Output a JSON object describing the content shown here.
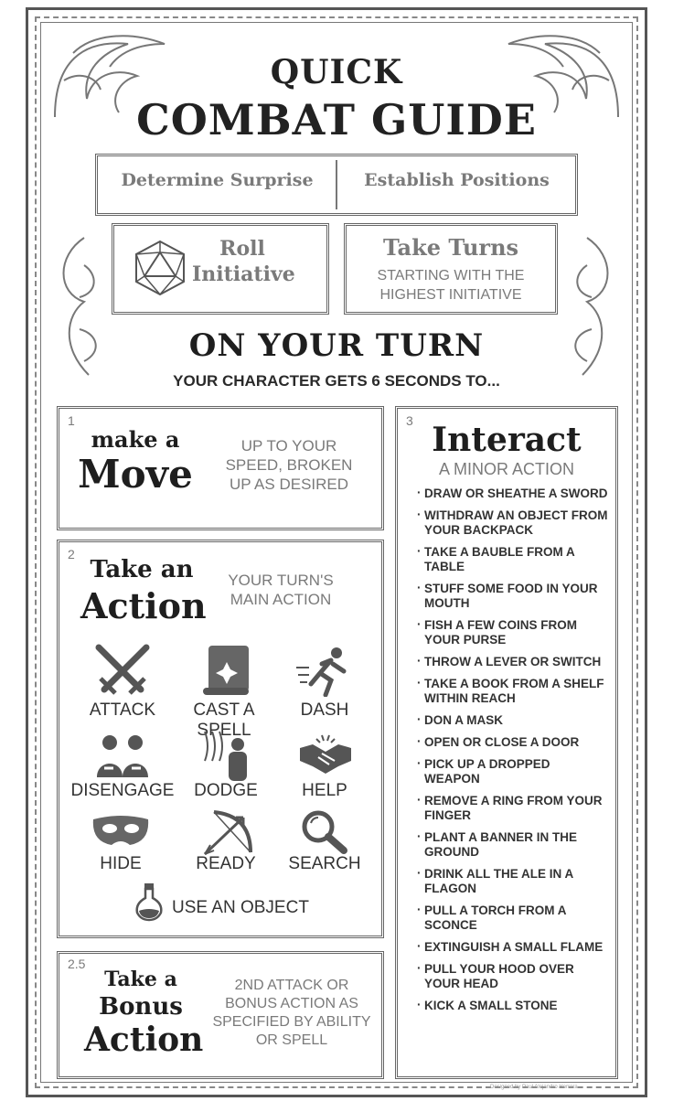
{
  "title": {
    "line1": "QUICK",
    "line2": "COMBAT GUIDE"
  },
  "setup": {
    "surprise": "Determine Surprise",
    "positions": "Establish Positions",
    "roll_initiative": "Roll Initiative",
    "take_turns_title": "Take Turns",
    "take_turns_desc": "STARTING WITH THE HIGHEST INITIATIVE"
  },
  "on_your_turn": {
    "heading": "ON YOUR TURN",
    "subheading": "YOUR CHARACTER GETS 6 SECONDS TO..."
  },
  "move": {
    "number": "1",
    "small": "make a",
    "big": "Move",
    "desc": "UP TO YOUR SPEED, BROKEN UP AS DESIRED"
  },
  "action": {
    "number": "2",
    "small": "Take an",
    "big": "Action",
    "desc": "YOUR TURN'S MAIN ACTION",
    "items": [
      {
        "label": "ATTACK",
        "icon": "crossed-swords-icon"
      },
      {
        "label": "CAST A SPELL",
        "icon": "scroll-icon"
      },
      {
        "label": "DASH",
        "icon": "running-figure-icon"
      },
      {
        "label": "DISENGAGE",
        "icon": "two-people-icon"
      },
      {
        "label": "DODGE",
        "icon": "dodge-figure-icon"
      },
      {
        "label": "HELP",
        "icon": "handshake-icon"
      },
      {
        "label": "HIDE",
        "icon": "mask-icon"
      },
      {
        "label": "READY",
        "icon": "bow-arrow-icon"
      },
      {
        "label": "SEARCH",
        "icon": "magnifier-icon"
      },
      {
        "label": "USE AN OBJECT",
        "icon": "potion-icon"
      }
    ]
  },
  "bonus": {
    "number": "2.5",
    "small": "Take a",
    "mid": "Bonus",
    "big": "Action",
    "desc": "2ND ATTACK OR BONUS ACTION AS SPECIFIED BY ABILITY OR SPELL"
  },
  "interact": {
    "number": "3",
    "title": "Interact",
    "subtitle": "A MINOR ACTION",
    "items": [
      "DRAW OR SHEATHE A SWORD",
      "WITHDRAW AN OBJECT FROM YOUR BACKPACK",
      "TAKE A BAUBLE FROM A TABLE",
      "STUFF SOME FOOD IN YOUR MOUTH",
      "FISH A FEW COINS FROM YOUR PURSE",
      "THROW A LEVER OR SWITCH",
      "TAKE A BOOK FROM A SHELF WITHIN REACH",
      "DON A MASK",
      "OPEN OR CLOSE A DOOR",
      "PICK UP A DROPPED WEAPON",
      "REMOVE A RING FROM YOUR FINGER",
      "PLANT A BANNER IN THE GROUND",
      "DRINK ALL THE ALE IN A FLAGON",
      "PULL A TORCH FROM A SCONCE",
      "EXTINGUISH A SMALL FLAME",
      "PULL YOUR HOOD OVER YOUR HEAD",
      "KICK A SMALL STONE"
    ]
  },
  "credit": "Designed by Paul Alejandro Herrera"
}
